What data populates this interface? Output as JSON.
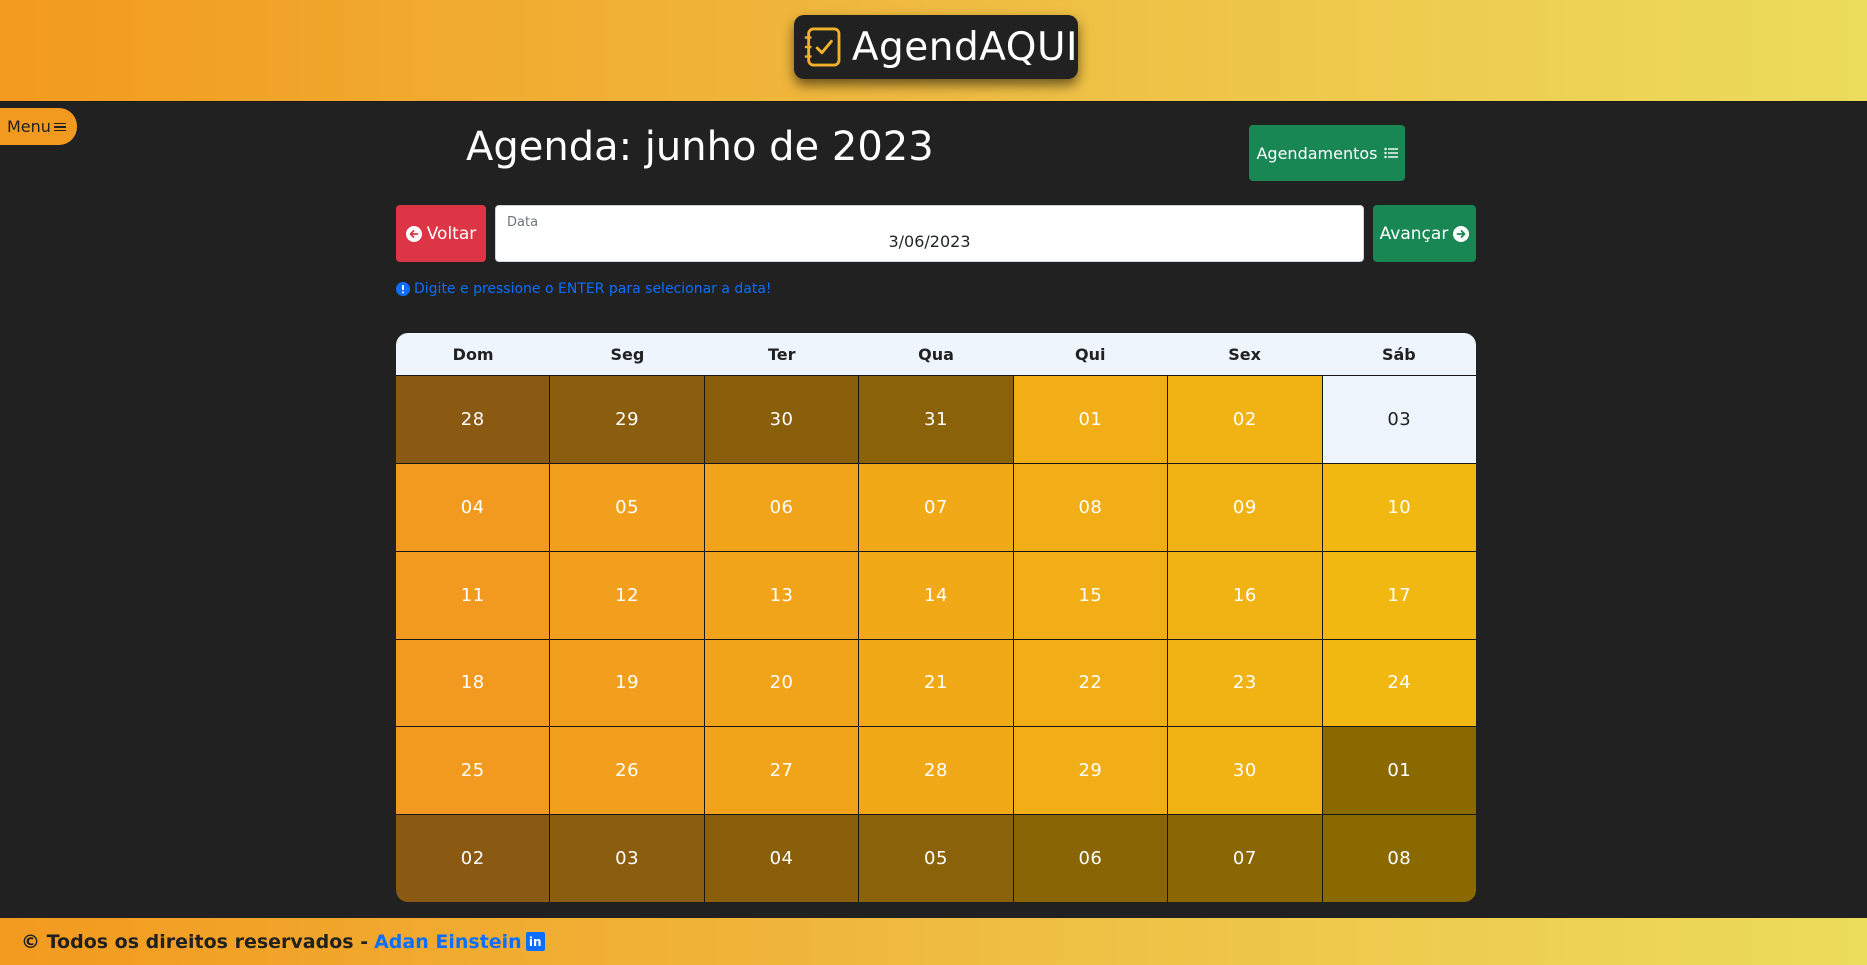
{
  "brand": {
    "name": "AgendAQUI"
  },
  "menu": {
    "label": "Menu"
  },
  "page": {
    "title": "Agenda: junho de 2023"
  },
  "actions": {
    "agendamentos_label": "Agendamentos",
    "voltar_label": "Voltar",
    "avancar_label": "Avançar"
  },
  "date_input": {
    "label": "Data",
    "value": "3/06/2023"
  },
  "hint": {
    "text": "Digite e pressione o ENTER para selecionar a data!"
  },
  "calendar": {
    "weekdays": [
      "Dom",
      "Seg",
      "Ter",
      "Qua",
      "Qui",
      "Sex",
      "Sáb"
    ],
    "days": [
      {
        "label": "28",
        "status": "other-month"
      },
      {
        "label": "29",
        "status": "other-month"
      },
      {
        "label": "30",
        "status": "other-month"
      },
      {
        "label": "31",
        "status": "other-month"
      },
      {
        "label": "01",
        "status": "current"
      },
      {
        "label": "02",
        "status": "current"
      },
      {
        "label": "03",
        "status": "selected"
      },
      {
        "label": "04",
        "status": "current"
      },
      {
        "label": "05",
        "status": "current"
      },
      {
        "label": "06",
        "status": "current"
      },
      {
        "label": "07",
        "status": "current"
      },
      {
        "label": "08",
        "status": "current"
      },
      {
        "label": "09",
        "status": "current"
      },
      {
        "label": "10",
        "status": "current"
      },
      {
        "label": "11",
        "status": "current"
      },
      {
        "label": "12",
        "status": "current"
      },
      {
        "label": "13",
        "status": "current"
      },
      {
        "label": "14",
        "status": "current"
      },
      {
        "label": "15",
        "status": "current"
      },
      {
        "label": "16",
        "status": "current"
      },
      {
        "label": "17",
        "status": "current"
      },
      {
        "label": "18",
        "status": "current"
      },
      {
        "label": "19",
        "status": "current"
      },
      {
        "label": "20",
        "status": "current"
      },
      {
        "label": "21",
        "status": "current"
      },
      {
        "label": "22",
        "status": "current"
      },
      {
        "label": "23",
        "status": "current"
      },
      {
        "label": "24",
        "status": "current"
      },
      {
        "label": "25",
        "status": "current"
      },
      {
        "label": "26",
        "status": "current"
      },
      {
        "label": "27",
        "status": "current"
      },
      {
        "label": "28",
        "status": "current"
      },
      {
        "label": "29",
        "status": "current"
      },
      {
        "label": "30",
        "status": "current"
      },
      {
        "label": "01",
        "status": "other-month"
      },
      {
        "label": "02",
        "status": "other-month"
      },
      {
        "label": "03",
        "status": "other-month"
      },
      {
        "label": "04",
        "status": "other-month"
      },
      {
        "label": "05",
        "status": "other-month"
      },
      {
        "label": "06",
        "status": "other-month"
      },
      {
        "label": "07",
        "status": "other-month"
      },
      {
        "label": "08",
        "status": "other-month"
      }
    ]
  },
  "footer": {
    "text": "© Todos os direitos reservados -",
    "author": "Adan Einstein",
    "linkedin_icon": "linkedin-icon"
  },
  "colors": {
    "header_gradient_start": "#f29a1f",
    "header_gradient_end": "#ecdc5c",
    "background": "#212121",
    "primary_green": "#198754",
    "danger_red": "#dc3545",
    "link_blue": "#0d6efd",
    "current_day_left": "#f29a1f",
    "current_day_right": "#f0b811",
    "other_day_left": "#8a5a12",
    "other_day_right": "#8a6a00",
    "selected_day": "#eef5fd"
  }
}
